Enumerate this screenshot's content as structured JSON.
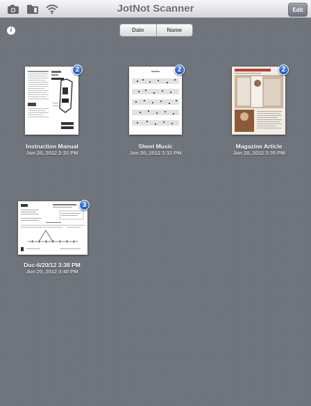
{
  "app": {
    "title": "JotNot Scanner"
  },
  "toolbar": {
    "edit_label": "Edit",
    "icons": [
      "camera-icon",
      "folder-import-icon",
      "wifi-icon"
    ]
  },
  "sort": {
    "options": [
      "Date",
      "Name"
    ]
  },
  "info": {
    "glyph": "i"
  },
  "documents": [
    {
      "title": "Instruction Manual",
      "date": "Jun 20, 2012 2:31 PM",
      "pages": "2"
    },
    {
      "title": "Sheet Music",
      "date": "Jun 20, 2012 3:32 PM",
      "pages": "2"
    },
    {
      "title": "Magazine Article",
      "date": "Jun 20, 2012 3:35 PM",
      "pages": "2"
    },
    {
      "title": "Doc-6/20/12 3:38 PM",
      "date": "Jun 20, 2012 3:40 PM",
      "pages": "3"
    }
  ],
  "colors": {
    "badge": "#2a62c2",
    "background": "#6f747c"
  }
}
